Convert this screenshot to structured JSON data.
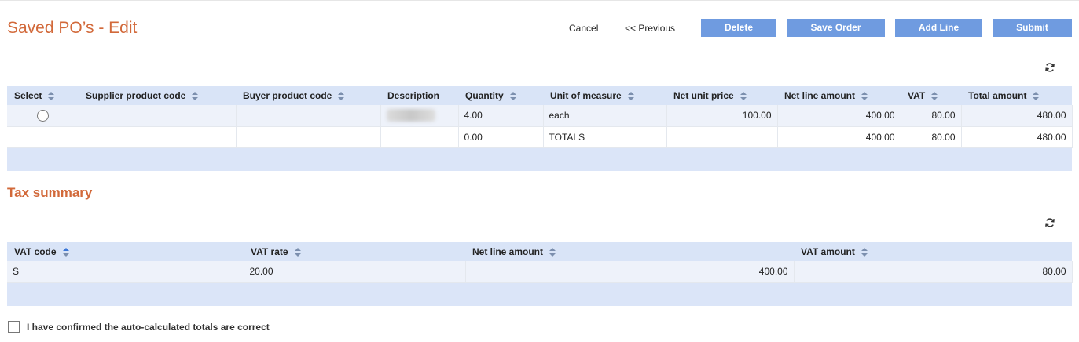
{
  "page_title": "Saved PO’s - Edit",
  "actions": {
    "cancel": "Cancel",
    "previous": "<< Previous",
    "delete": "Delete",
    "save_order": "Save Order",
    "add_line": "Add Line",
    "submit": "Submit"
  },
  "colors": {
    "accent_title": "#d2693a",
    "button": "#6f9be0",
    "header_bg": "#d9e4f7"
  },
  "lines_table": {
    "columns": [
      "Select",
      "Supplier product code",
      "Buyer product code",
      "Description",
      "Quantity",
      "Unit of measure",
      "Net unit price",
      "Net line amount",
      "VAT",
      "Total amount"
    ],
    "rows": [
      {
        "supplier_code": "",
        "buyer_code": "",
        "quantity": "4.00",
        "uom": "each",
        "net_unit_price": "100.00",
        "net_line_amount": "400.00",
        "vat": "80.00",
        "total_amount": "480.00"
      }
    ],
    "totals": {
      "quantity": "0.00",
      "label": "TOTALS",
      "net_line_amount": "400.00",
      "vat": "80.00",
      "total_amount": "480.00"
    }
  },
  "tax_summary": {
    "title": "Tax summary",
    "columns": [
      "VAT code",
      "VAT rate",
      "Net line amount",
      "VAT amount"
    ],
    "rows": [
      {
        "vat_code": "S",
        "vat_rate": "20.00",
        "net_line_amount": "400.00",
        "vat_amount": "80.00"
      }
    ]
  },
  "confirm_label": "I have confirmed the auto-calculated totals are correct"
}
